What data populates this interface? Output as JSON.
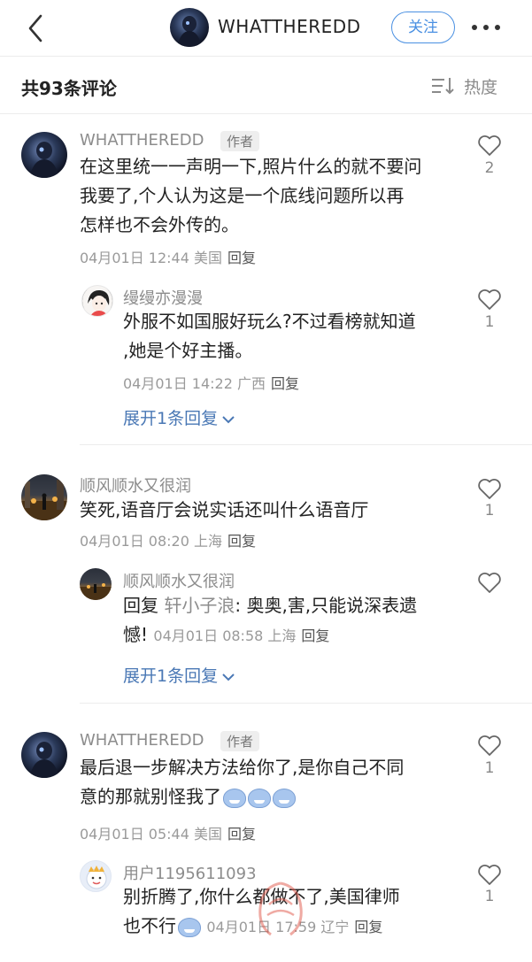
{
  "nav": {
    "title": "WHATTHEREDD",
    "follow_label": "关注"
  },
  "header": {
    "count_title": "共93条评论",
    "sort_label": "热度"
  },
  "comments": [
    {
      "username": "WHATTHEREDD",
      "tag": "作者",
      "text_lines": [
        "在这里统一一声明一下,照片什么的就不要问",
        "我要了,个人认为这是一个底线问题所以再",
        "怎样也不会外传的。"
      ],
      "meta": "04月01日 12:44 美国",
      "reply_label": "回复",
      "likes": "2",
      "reply": {
        "username": "缦缦亦漫漫",
        "text_lines": [
          "外服不如国服好玩么?不过看榜就知道",
          ",她是个好主播。"
        ],
        "meta": "04月01日 14:22 广西",
        "reply_label": "回复",
        "likes": "1"
      },
      "expand_label": "展开1条回复"
    },
    {
      "username": "顺风顺水又很润",
      "text_lines": [
        "笑死,语音厅会说实话还叫什么语音厅"
      ],
      "meta": "04月01日 08:20 上海",
      "reply_label": "回复",
      "likes": "1",
      "reply": {
        "username": "顺风顺水又很润",
        "prefix": "回复",
        "mention": "轩小子浪",
        "text_line1": ": 奥奥,害,只能说深表遗",
        "text_line2": "憾!",
        "meta": "04月01日 08:58 上海",
        "reply_label": "回复"
      },
      "expand_label": "展开1条回复"
    },
    {
      "username": "WHATTHEREDD",
      "tag": "作者",
      "text_lines": [
        "最后退一步解决方法给你了,是你自己不同",
        "意的那就别怪我了"
      ],
      "meta": "04月01日 05:44 美国",
      "reply_label": "回复",
      "likes": "1",
      "reply": {
        "username": "用户1195611093",
        "text_line1": "别折腾了,你什么都做不了,美国律师",
        "text_line2": "也不行",
        "meta": "04月01日 17:59 辽宁",
        "reply_label": "回复",
        "likes": "1"
      }
    }
  ],
  "icons": {
    "back": "chevron-left-icon",
    "more": "more-dots-icon",
    "sort": "sort-icon",
    "like": "heart-outline-icon",
    "expand": "chevron-down-icon",
    "emoji": "crying-laugh-emoji-icon"
  },
  "colors": {
    "accent": "#4a90e2",
    "link": "#4a78b5",
    "muted": "#8c8c8c"
  }
}
